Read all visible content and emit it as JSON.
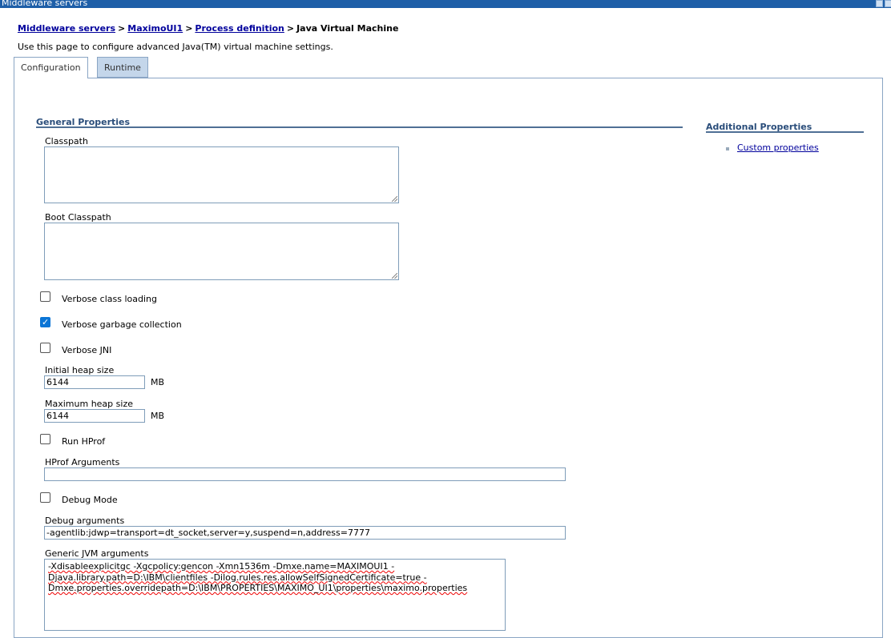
{
  "window": {
    "title": "Middleware servers"
  },
  "breadcrumb": {
    "items": [
      "Middleware servers",
      "MaximoUI1",
      "Process definition"
    ],
    "current": "Java Virtual Machine",
    "separator": ">"
  },
  "page": {
    "description": "Use this page to configure advanced Java(TM) virtual machine settings."
  },
  "tabs": [
    {
      "label": "Configuration",
      "active": true
    },
    {
      "label": "Runtime",
      "active": false
    }
  ],
  "general": {
    "title": "General Properties",
    "classpath_label": "Classpath",
    "classpath_value": "",
    "boot_classpath_label": "Boot Classpath",
    "boot_classpath_value": "",
    "verbose_class_loading": {
      "label": "Verbose class loading",
      "checked": false
    },
    "verbose_gc": {
      "label": "Verbose garbage collection",
      "checked": true
    },
    "verbose_jni": {
      "label": "Verbose JNI",
      "checked": false
    },
    "initial_heap_label": "Initial heap size",
    "initial_heap_value": "6144",
    "initial_heap_unit": "MB",
    "max_heap_label": "Maximum heap size",
    "max_heap_value": "6144",
    "max_heap_unit": "MB",
    "run_hprof": {
      "label": "Run HProf",
      "checked": false
    },
    "hprof_args_label": "HProf Arguments",
    "hprof_args_value": "",
    "debug_mode": {
      "label": "Debug Mode",
      "checked": false
    },
    "debug_args_label": "Debug arguments",
    "debug_args_value": "-agentlib:jdwp=transport=dt_socket,server=y,suspend=n,address=7777",
    "generic_jvm_label": "Generic JVM arguments",
    "generic_jvm_lines": [
      "-Xdisableexplicitgc  -Xgcpolicy:gencon  -Xmn1536m -Dmxe.name=MAXIMOUI1 -",
      "Djava.library.path=D:\\IBM\\clientfiles -Dilog.rules.res.allowSelfSignedCertificate=true -",
      "Dmxe.properties.overridepath=D:\\IBM\\PROPERTIES\\MAXIMO_UI1\\properties\\maximo.properties"
    ]
  },
  "additional": {
    "title": "Additional Properties",
    "links": [
      "Custom properties"
    ]
  },
  "colors": {
    "link": "#00009c",
    "titlebar": "#1e5fa8",
    "section_title": "#2a4d7a",
    "tab_inactive_bg": "#c4d6ea",
    "checkbox_checked": "#0b75d6"
  }
}
